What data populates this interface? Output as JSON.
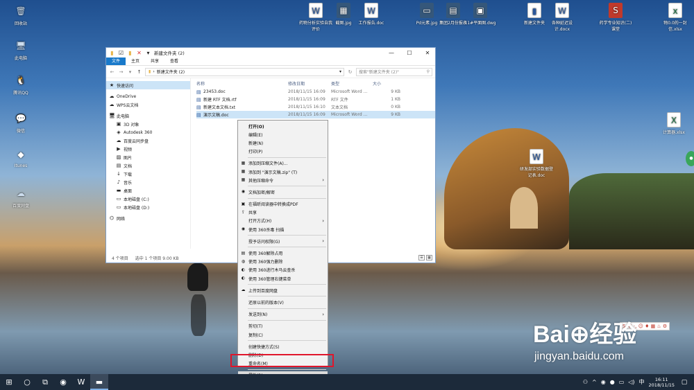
{
  "desktop": {
    "left_icons": [
      {
        "label": "回收站",
        "glyph": "🗑",
        "kind": "pc"
      },
      {
        "label": "此电脑",
        "glyph": "🖥",
        "kind": "pc"
      },
      {
        "label": "腾讯QQ",
        "glyph": "🐧",
        "kind": "qq"
      },
      {
        "label": "微信",
        "glyph": "💬",
        "kind": "qq"
      },
      {
        "label": "Itunes",
        "glyph": "◆",
        "kind": "qq"
      },
      {
        "label": "百度网盘",
        "glyph": "☁",
        "kind": "pc"
      }
    ],
    "top_icons": [
      {
        "label": "药物分析实验自我评价",
        "glyph": "W",
        "kind": "doc"
      },
      {
        "label": "截图.jpg",
        "glyph": "▦",
        "kind": "img"
      },
      {
        "label": "工作报告.doc",
        "glyph": "W",
        "kind": "doc"
      },
      {
        "label": "Pd元素.jpg",
        "glyph": "▭",
        "kind": "img"
      },
      {
        "label": "集团2月份报表",
        "glyph": "▤",
        "kind": "img"
      },
      {
        "label": "11#平面图.dwg",
        "glyph": "▣",
        "kind": "img"
      },
      {
        "label": "新建文件夹",
        "glyph": "▮",
        "kind": "doc"
      },
      {
        "label": "各种延迟设计.docx",
        "glyph": "W",
        "kind": "doc"
      },
      {
        "label": "药学专业知识(二)课堂",
        "glyph": "S",
        "kind": "app"
      },
      {
        "label": "物0.0的一封信.xlsx",
        "glyph": "x",
        "kind": "xls"
      }
    ],
    "right_icons": [
      {
        "label": "计算器.xlsx",
        "glyph": "X",
        "kind": "xls"
      },
      {
        "label": "研发部实验数据登记表.doc",
        "glyph": "W",
        "kind": "doc"
      }
    ]
  },
  "explorer": {
    "title": "新建文件夹 (2)",
    "ribbon_tabs": [
      "文件",
      "主页",
      "共享",
      "查看"
    ],
    "path": "新建文件夹 (2)",
    "search_placeholder": "搜索\"新建文件夹 (2)\"",
    "nav_items": [
      {
        "label": "快速访问",
        "icon": "★",
        "level": 1,
        "selected": true
      },
      {
        "label": "OneDrive",
        "icon": "☁",
        "level": 1
      },
      {
        "label": "WPS云文档",
        "icon": "☁",
        "level": 1
      },
      {
        "label": "此电脑",
        "icon": "🖥",
        "level": 1
      },
      {
        "label": "3D 对象",
        "icon": "▣",
        "level": 2
      },
      {
        "label": "Autodesk 360",
        "icon": "◈",
        "level": 2
      },
      {
        "label": "百度云同步盘",
        "icon": "☁",
        "level": 2
      },
      {
        "label": "视频",
        "icon": "▶",
        "level": 2
      },
      {
        "label": "图片",
        "icon": "▨",
        "level": 2
      },
      {
        "label": "文档",
        "icon": "▤",
        "level": 2
      },
      {
        "label": "下载",
        "icon": "↓",
        "level": 2
      },
      {
        "label": "音乐",
        "icon": "♪",
        "level": 2
      },
      {
        "label": "桌面",
        "icon": "▬",
        "level": 2
      },
      {
        "label": "本地磁盘 (C:)",
        "icon": "▭",
        "level": 2
      },
      {
        "label": "本地磁盘 (D:)",
        "icon": "▭",
        "level": 2
      },
      {
        "label": "网络",
        "icon": "⌬",
        "level": 1
      }
    ],
    "columns": [
      "名称",
      "修改日期",
      "类型",
      "大小"
    ],
    "files": [
      {
        "name": "23453.doc",
        "date": "2018/11/15 16:09",
        "type": "Microsoft Word ...",
        "size": "9 KB",
        "selected": false
      },
      {
        "name": "新建 RTF 文档.rtf",
        "date": "2018/11/15 16:09",
        "type": "RTF 文件",
        "size": "1 KB",
        "selected": false
      },
      {
        "name": "新建文本文档.txt",
        "date": "2018/11/15 16:10",
        "type": "文本文档",
        "size": "0 KB",
        "selected": false
      },
      {
        "name": "演示文稿.doc",
        "date": "2018/11/15 16:09",
        "type": "Microsoft Word ...",
        "size": "9 KB",
        "selected": true
      }
    ],
    "status": {
      "count": "4 个项目",
      "selected": "选中 1 个项目  9.00 KB"
    }
  },
  "context_menu": {
    "items": [
      {
        "label": "打开(O)",
        "bold": true
      },
      {
        "label": "编辑(E)"
      },
      {
        "label": "新建(N)"
      },
      {
        "label": "打印(P)"
      },
      {
        "sep": true
      },
      {
        "label": "添加到压缩文件(A)...",
        "icon": "▦"
      },
      {
        "label": "添加到 \"演示文稿.zip\" (T)",
        "icon": "▦"
      },
      {
        "label": "其他压缩命令",
        "icon": "▦",
        "submenu": true
      },
      {
        "sep": true
      },
      {
        "label": "文档加密/解密",
        "icon": "◉"
      },
      {
        "sep": true
      },
      {
        "label": "在福昕阅读器中转换成PDF",
        "icon": "▣"
      },
      {
        "label": "共享",
        "icon": "⇪"
      },
      {
        "label": "打开方式(H)",
        "submenu": true
      },
      {
        "label": "使用 360杀毒 扫描",
        "icon": "◉"
      },
      {
        "sep": true
      },
      {
        "label": "授予访问权限(G)",
        "submenu": true
      },
      {
        "sep": true
      },
      {
        "label": "使用 360解除占用",
        "icon": "▤"
      },
      {
        "label": "使用 360强力删除",
        "icon": "◍"
      },
      {
        "label": "使用 360进行木马云查杀",
        "icon": "◐"
      },
      {
        "label": "使用 360管理右键菜单",
        "icon": "◐"
      },
      {
        "sep": true
      },
      {
        "label": "上传到百度网盘",
        "icon": "☁"
      },
      {
        "sep": true
      },
      {
        "label": "还原以前的版本(V)"
      },
      {
        "sep": true
      },
      {
        "label": "发送到(N)",
        "submenu": true
      },
      {
        "sep": true
      },
      {
        "label": "剪切(T)"
      },
      {
        "label": "复制(C)"
      },
      {
        "sep": true
      },
      {
        "label": "创建快捷方式(S)"
      },
      {
        "label": "删除(D)"
      },
      {
        "label": "重命名(M)"
      },
      {
        "sep": true
      },
      {
        "label": "属性(R)",
        "highlight": true
      }
    ]
  },
  "watermark": {
    "brand": "Bai⊕经验",
    "url": "jingyan.baidu.com"
  },
  "ime_bar": {
    "text": "S 中 ·, ☺ ♦ ▦ ♨ ⚙"
  },
  "taskbar": {
    "items": [
      {
        "name": "start-button",
        "glyph": "⊞"
      },
      {
        "name": "search-button",
        "glyph": "○"
      },
      {
        "name": "task-view-button",
        "glyph": "⧉"
      },
      {
        "name": "chrome-taskbar-button",
        "glyph": "◉"
      },
      {
        "name": "word-taskbar-button",
        "glyph": "W"
      },
      {
        "name": "explorer-taskbar-button",
        "glyph": "▬",
        "active": true
      }
    ],
    "time": "16:11",
    "date": "2018/11/15"
  }
}
